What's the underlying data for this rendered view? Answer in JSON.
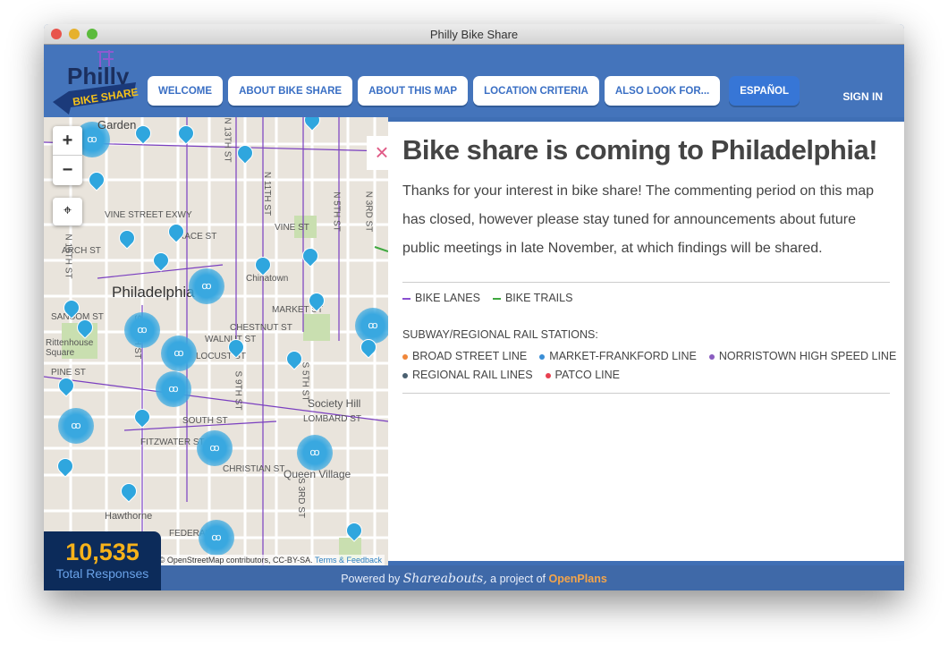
{
  "window": {
    "title": "Philly Bike Share"
  },
  "logo": {
    "line1": "Philly",
    "line2": "BIKE SHARE"
  },
  "nav": [
    "WELCOME",
    "ABOUT BIKE SHARE",
    "ABOUT THIS MAP",
    "LOCATION CRITERIA",
    "ALSO LOOK FOR...",
    "ESPAÑOL"
  ],
  "signin": "SIGN IN",
  "map": {
    "zoom_in": "+",
    "zoom_out": "−",
    "labels": [
      "Garden",
      "VINE STREET EXWY",
      "VINE ST",
      "ARCH ST",
      "RACE ST",
      "Philadelphia",
      "Chinatown",
      "SANSOM ST",
      "CHESTNUT ST",
      "MARKET ST",
      "Rittenhouse Square",
      "WALNUT ST",
      "LOCUST ST",
      "PINE ST",
      "LOMBARD ST",
      "SOUTH ST",
      "Society Hill",
      "FITZWATER ST",
      "CHRISTIAN ST",
      "Queen Village",
      "Hawthorne",
      "FEDERAL ST",
      "N 18TH ST",
      "N 13TH ST",
      "N 11TH ST",
      "N 5TH ST",
      "N 3RD ST",
      "S 16TH ST",
      "S 9TH ST",
      "S 5TH ST",
      "S 3RD ST"
    ],
    "attribution": "© OpenStreetMap contributors, CC-BY-SA.",
    "terms": "Terms & Feedback"
  },
  "panel": {
    "close": "×",
    "title": "Bike share is coming to Philadelphia!",
    "intro": "Thanks for your interest in bike share! The commenting period on this map has closed, however please stay tuned for announcements about future public meetings in late November, at which findings will be shared.",
    "lanes": [
      {
        "label": "BIKE LANES",
        "color": "#8a4fd0"
      },
      {
        "label": "BIKE TRAILS",
        "color": "#3fa83f"
      }
    ],
    "stations_heading": "SUBWAY/REGIONAL RAIL STATIONS:",
    "stations": [
      {
        "label": "BROAD STREET LINE",
        "color": "#f0873a"
      },
      {
        "label": "MARKET-FRANKFORD LINE",
        "color": "#3a8ed6"
      },
      {
        "label": "NORRISTOWN HIGH SPEED LINE",
        "color": "#8a5cc0"
      },
      {
        "label": "REGIONAL RAIL LINES",
        "color": "#4a6070"
      },
      {
        "label": "PATCO LINE",
        "color": "#e84050"
      }
    ]
  },
  "counter": {
    "value": "10,535",
    "label": "Total Responses"
  },
  "footer": {
    "powered": "Powered by",
    "brand": "Shareabouts,",
    "project": "a project of",
    "org": "OpenPlans"
  }
}
